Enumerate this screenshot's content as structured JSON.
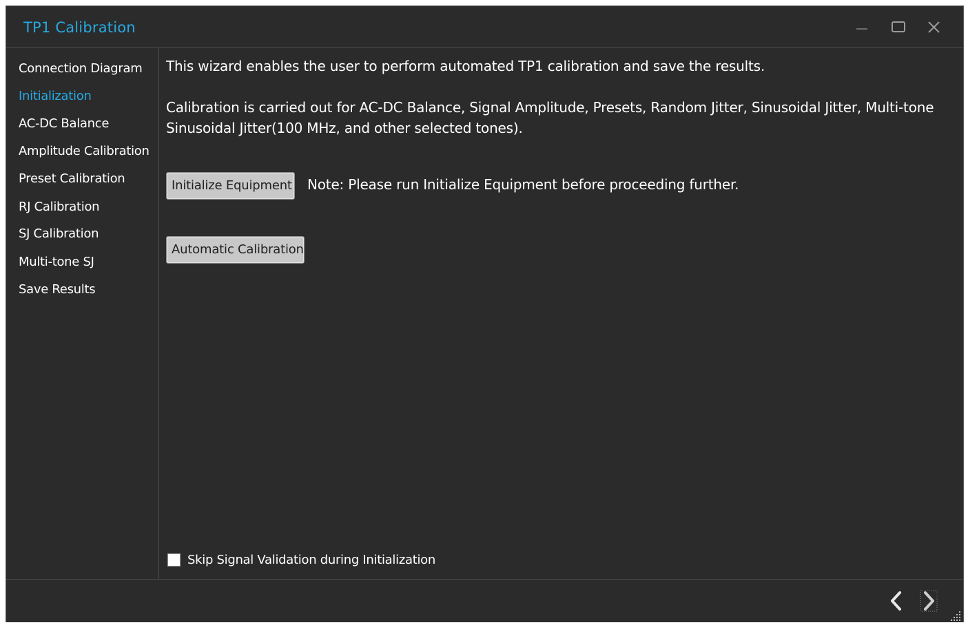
{
  "window": {
    "title": "TP1 Calibration",
    "accent_color": "#27a9e1",
    "background_color": "#2b2b2b",
    "controls": [
      "minimize-icon",
      "maximize-icon",
      "close-icon"
    ]
  },
  "sidebar": {
    "items": [
      {
        "label": "Connection Diagram",
        "active": false
      },
      {
        "label": "Initialization",
        "active": true
      },
      {
        "label": "AC-DC Balance",
        "active": false
      },
      {
        "label": "Amplitude Calibration",
        "active": false
      },
      {
        "label": "Preset Calibration",
        "active": false
      },
      {
        "label": "RJ Calibration",
        "active": false
      },
      {
        "label": "SJ Calibration",
        "active": false
      },
      {
        "label": "Multi-tone SJ",
        "active": false
      },
      {
        "label": "Save Results",
        "active": false
      }
    ]
  },
  "main": {
    "intro": "This wizard enables the user to perform automated TP1 calibration and save the results.",
    "description": "Calibration is carried out for AC-DC Balance, Signal Amplitude, Presets, Random Jitter, Sinusoidal Jitter, Multi-tone Sinusoidal Jitter(100 MHz, and other selected tones).",
    "initialize_button": "Initialize Equipment",
    "note": "Note: Please run Initialize Equipment before proceeding further.",
    "automatic_button": "Automatic Calibration",
    "skip_checkbox": {
      "label": "Skip Signal Validation during Initialization",
      "checked": false
    }
  },
  "footer": {
    "icons": [
      "chevron-left-icon",
      "chevron-right-icon",
      "resize-grip-icon"
    ]
  }
}
